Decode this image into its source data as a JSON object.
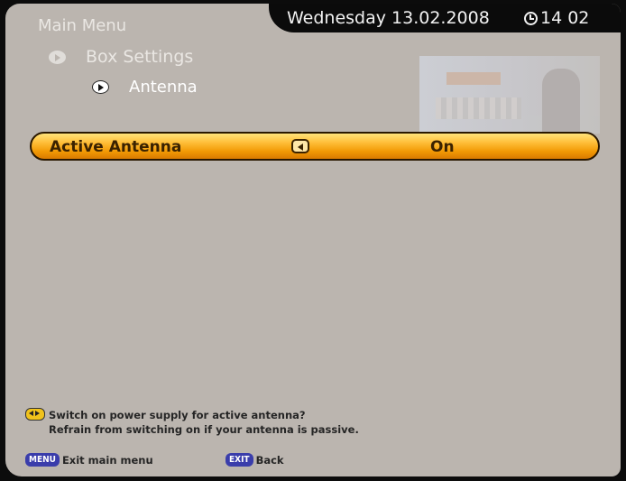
{
  "header": {
    "date": "Wednesday 13.02.2008",
    "time": "14 02",
    "clock_icon": "clock-icon"
  },
  "menu": {
    "title": "Main Menu",
    "breadcrumb": [
      {
        "label": "Box Settings",
        "icon": "arrow-right-icon"
      },
      {
        "label": "Antenna",
        "icon": "arrow-right-icon"
      }
    ]
  },
  "options": [
    {
      "label": "Active Antenna",
      "value": "On",
      "nav_icon": "left-arrow-icon"
    }
  ],
  "help": {
    "icon": "left-right-icon",
    "line1": "Switch on power supply for active antenna?",
    "line2": "Refrain from switching on if your antenna is passive."
  },
  "footer": {
    "menu_key": "MENU",
    "menu_label": "Exit main menu",
    "exit_key": "EXIT",
    "exit_label": "Back"
  },
  "colors": {
    "background": "#bbb5af",
    "highlight": "#f29a05",
    "tab": "#0b0b0b"
  }
}
